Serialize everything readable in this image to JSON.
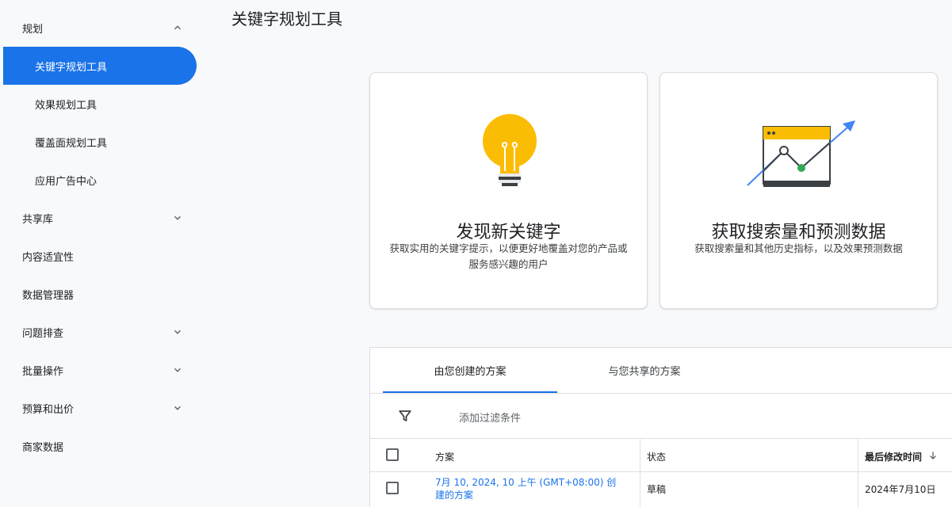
{
  "page": {
    "title": "关键字规划工具"
  },
  "sidebar": {
    "items": [
      {
        "label": "规划",
        "chevron": "up"
      },
      {
        "label": "关键字规划工具",
        "active": true
      },
      {
        "label": "效果规划工具"
      },
      {
        "label": "覆盖面规划工具"
      },
      {
        "label": "应用广告中心"
      },
      {
        "label": "共享库",
        "chevron": "down"
      },
      {
        "label": "内容适宜性"
      },
      {
        "label": "数据管理器"
      },
      {
        "label": "问题排查",
        "chevron": "down"
      },
      {
        "label": "批量操作",
        "chevron": "down"
      },
      {
        "label": "预算和出价",
        "chevron": "down"
      },
      {
        "label": "商家数据"
      }
    ]
  },
  "cards": [
    {
      "icon": "lightbulb-icon",
      "title": "发现新关键字",
      "desc": "获取实用的关键字提示，以便更好地覆盖对您的产品或服务感兴趣的用户"
    },
    {
      "icon": "growth-chart-icon",
      "title": "获取搜索量和预测数据",
      "desc": "获取搜索量和其他历史指标，以及效果预测数据"
    }
  ],
  "plans": {
    "tabs": [
      {
        "label": "由您创建的方案",
        "active": true
      },
      {
        "label": "与您共享的方案"
      }
    ],
    "filter": {
      "label": "添加过滤条件",
      "icon": "filter-icon"
    },
    "columns": {
      "plan": "方案",
      "status": "状态",
      "modified": "最后修改时间"
    },
    "rows": [
      {
        "plan": "7月 10, 2024, 10 上午 (GMT+08:00) 创建的方案",
        "status": "草稿",
        "modified": "2024年7月10日"
      }
    ]
  },
  "colors": {
    "accent": "#1a73e8",
    "bulb": "#fbbc04",
    "green": "#34a853"
  }
}
